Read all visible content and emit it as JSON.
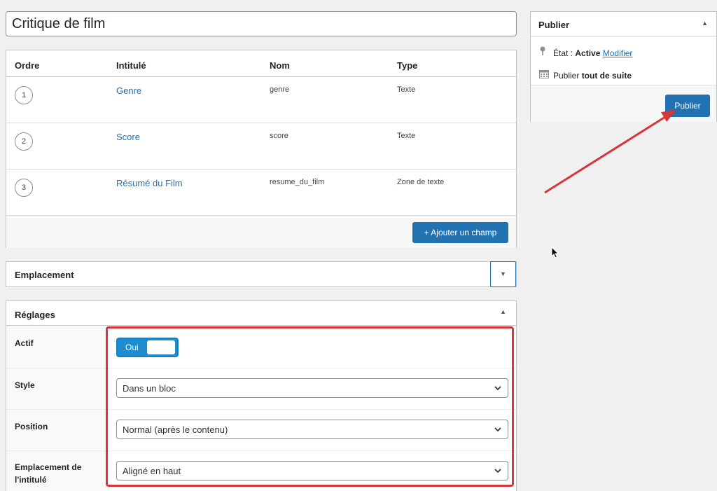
{
  "post_title": "Critique de film",
  "fields_table": {
    "headers": {
      "order": "Ordre",
      "label": "Intitulé",
      "name": "Nom",
      "type": "Type"
    },
    "rows": [
      {
        "order": "1",
        "label": "Genre",
        "name": "genre",
        "type": "Texte"
      },
      {
        "order": "2",
        "label": "Score",
        "name": "score",
        "type": "Texte"
      },
      {
        "order": "3",
        "label": "Résumé du Film",
        "name": "resume_du_film",
        "type": "Zone de texte"
      }
    ],
    "add_button": "+ Ajouter un champ"
  },
  "location_box": {
    "title": "Emplacement"
  },
  "settings_box": {
    "title": "Réglages",
    "active": {
      "label": "Actif",
      "toggle_text": "Oui",
      "value": true
    },
    "style": {
      "label": "Style",
      "selected": "Dans un bloc"
    },
    "position": {
      "label": "Position",
      "selected": "Normal (après le contenu)"
    },
    "label_placement": {
      "label_line1": "Emplacement de",
      "label_line2": "l'intitulé",
      "selected": "Aligné en haut"
    }
  },
  "publish_box": {
    "title": "Publier",
    "status_prefix": "État : ",
    "status_value": "Active",
    "status_edit_link": "Modifier",
    "schedule_prefix": "Publier ",
    "schedule_value": "tout de suite",
    "publish_button": "Publier"
  },
  "colors": {
    "accent": "#2271b1",
    "highlight": "#d63638",
    "toggle": "#1e8cce"
  },
  "icons": {
    "status": "pin-icon",
    "schedule": "calendar-icon",
    "collapse": "caret-up-icon",
    "expand": "caret-down-icon",
    "select": "chevron-down-icon"
  }
}
